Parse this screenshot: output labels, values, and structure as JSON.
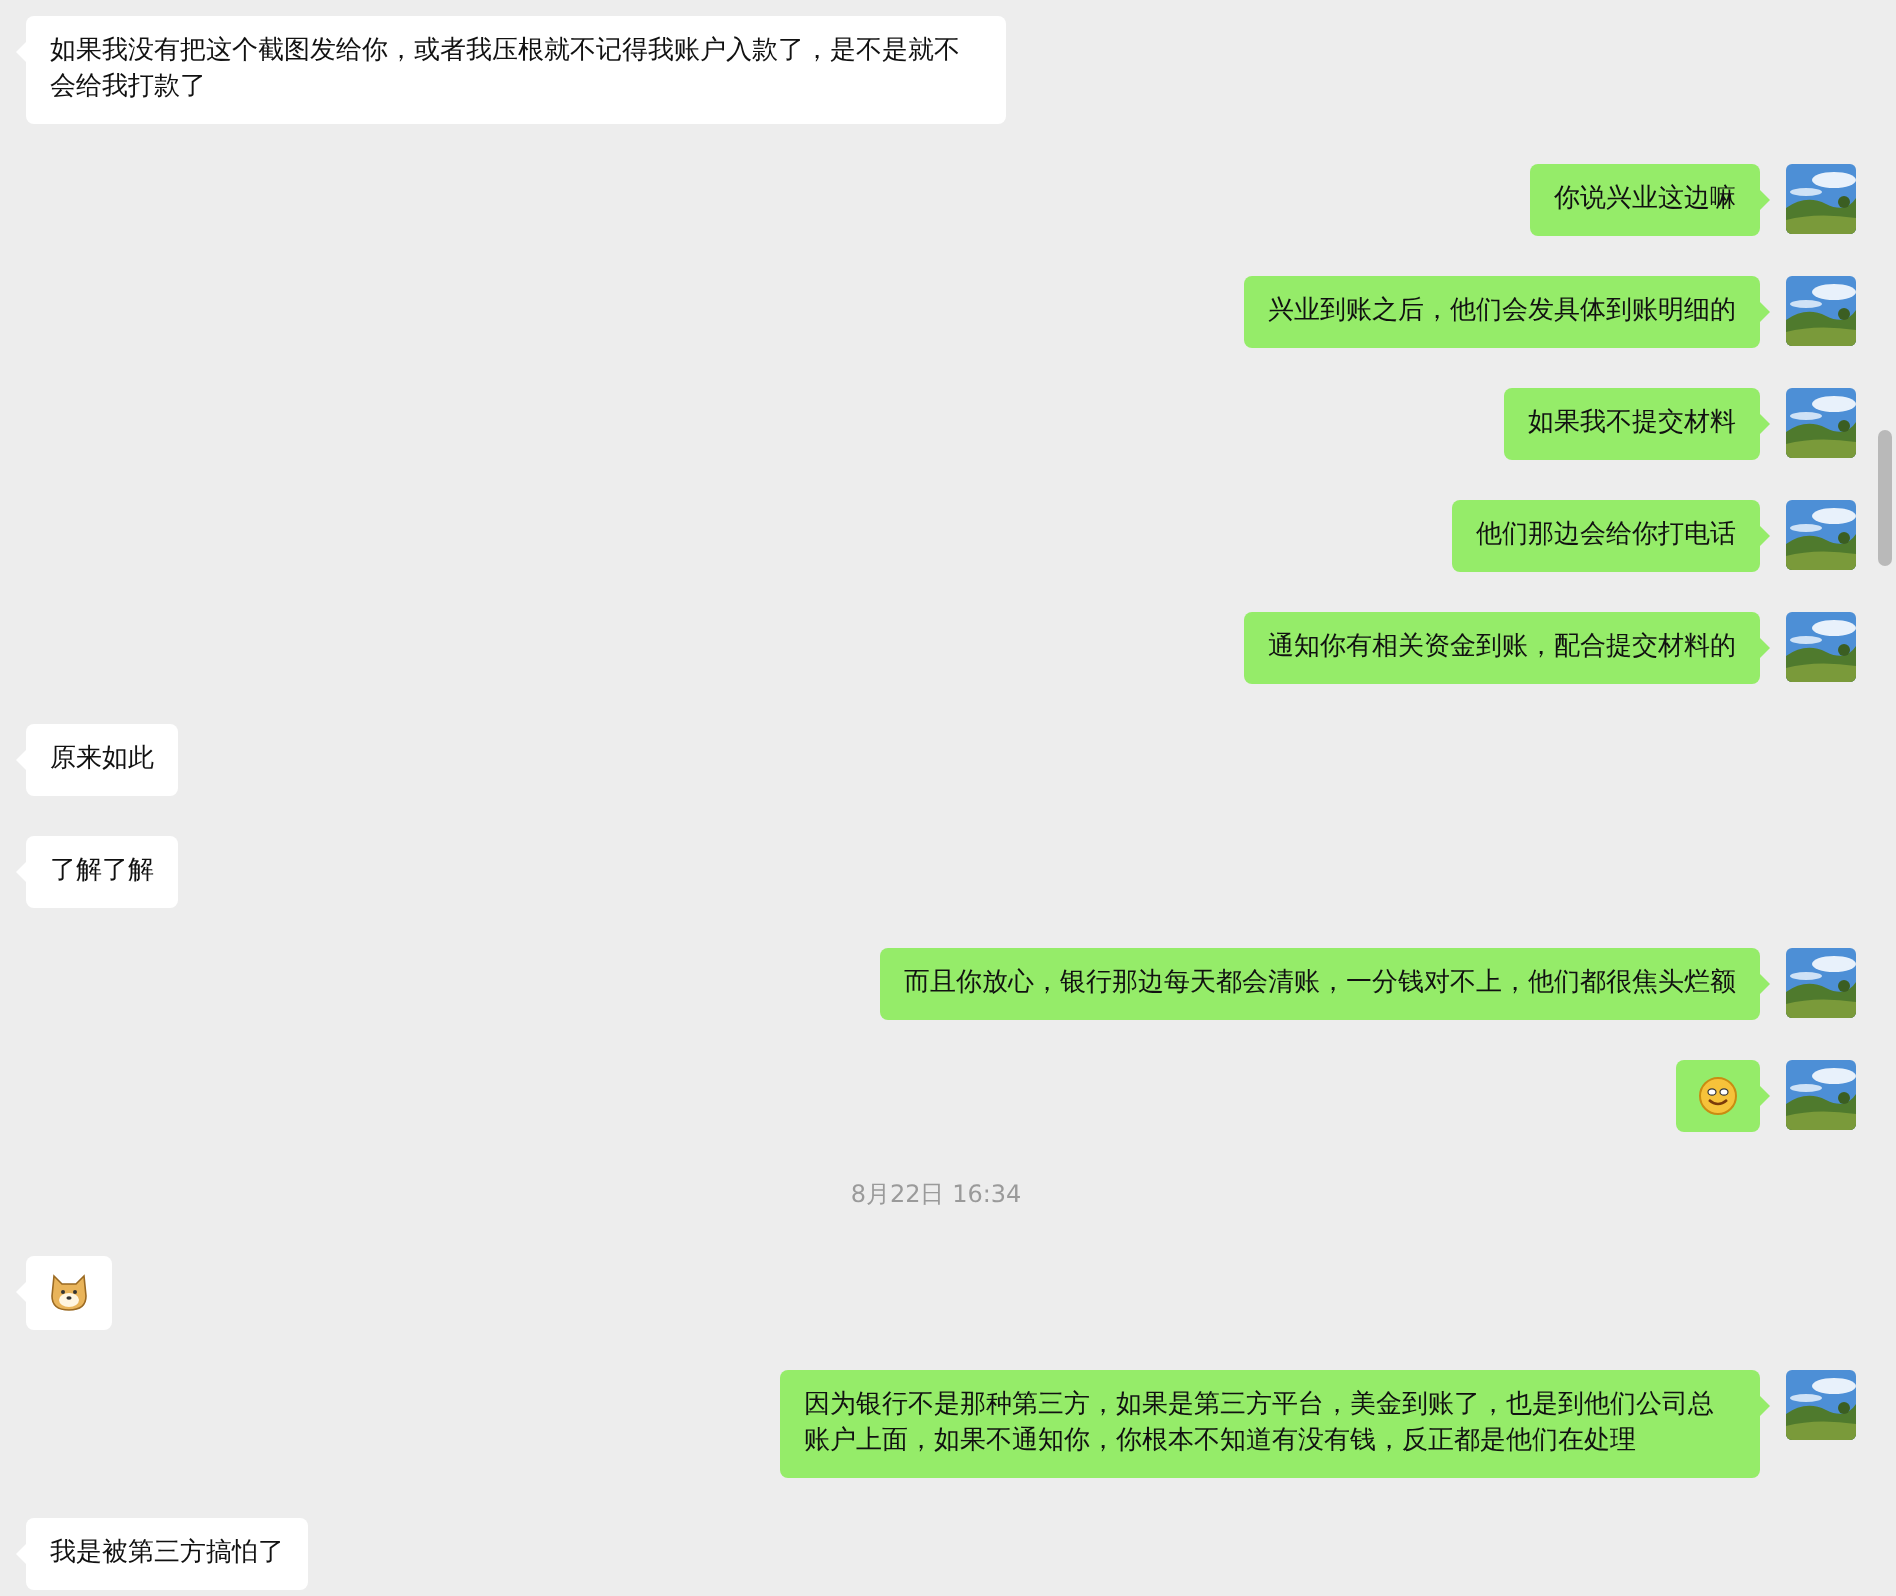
{
  "messages": [
    {
      "kind": "text",
      "outgoing": false,
      "text": "如果我没有把这个截图发给你，或者我压根就不记得我账户入款了，是不是就不会给我打款了"
    },
    {
      "kind": "text",
      "outgoing": true,
      "text": "你说兴业这边嘛"
    },
    {
      "kind": "text",
      "outgoing": true,
      "text": "兴业到账之后，他们会发具体到账明细的"
    },
    {
      "kind": "text",
      "outgoing": true,
      "text": "如果我不提交材料"
    },
    {
      "kind": "text",
      "outgoing": true,
      "text": "他们那边会给你打电话"
    },
    {
      "kind": "text",
      "outgoing": true,
      "text": "通知你有相关资金到账，配合提交材料的"
    },
    {
      "kind": "text",
      "outgoing": false,
      "text": "原来如此"
    },
    {
      "kind": "text",
      "outgoing": false,
      "text": "了解了解"
    },
    {
      "kind": "text",
      "outgoing": true,
      "text": "而且你放心，银行那边每天都会清账，一分钱对不上，他们都很焦头烂额"
    },
    {
      "kind": "smiley",
      "outgoing": true
    },
    {
      "kind": "timestamp",
      "text": "8月22日 16:34"
    },
    {
      "kind": "dog",
      "outgoing": false
    },
    {
      "kind": "text",
      "outgoing": true,
      "text": "因为银行不是那种第三方，如果是第三方平台，美金到账了，也是到他们公司总账户上面，如果不通知你，你根本不知道有没有钱，反正都是他们在处理"
    },
    {
      "kind": "text",
      "outgoing": false,
      "text": "我是被第三方搞怕了"
    }
  ]
}
